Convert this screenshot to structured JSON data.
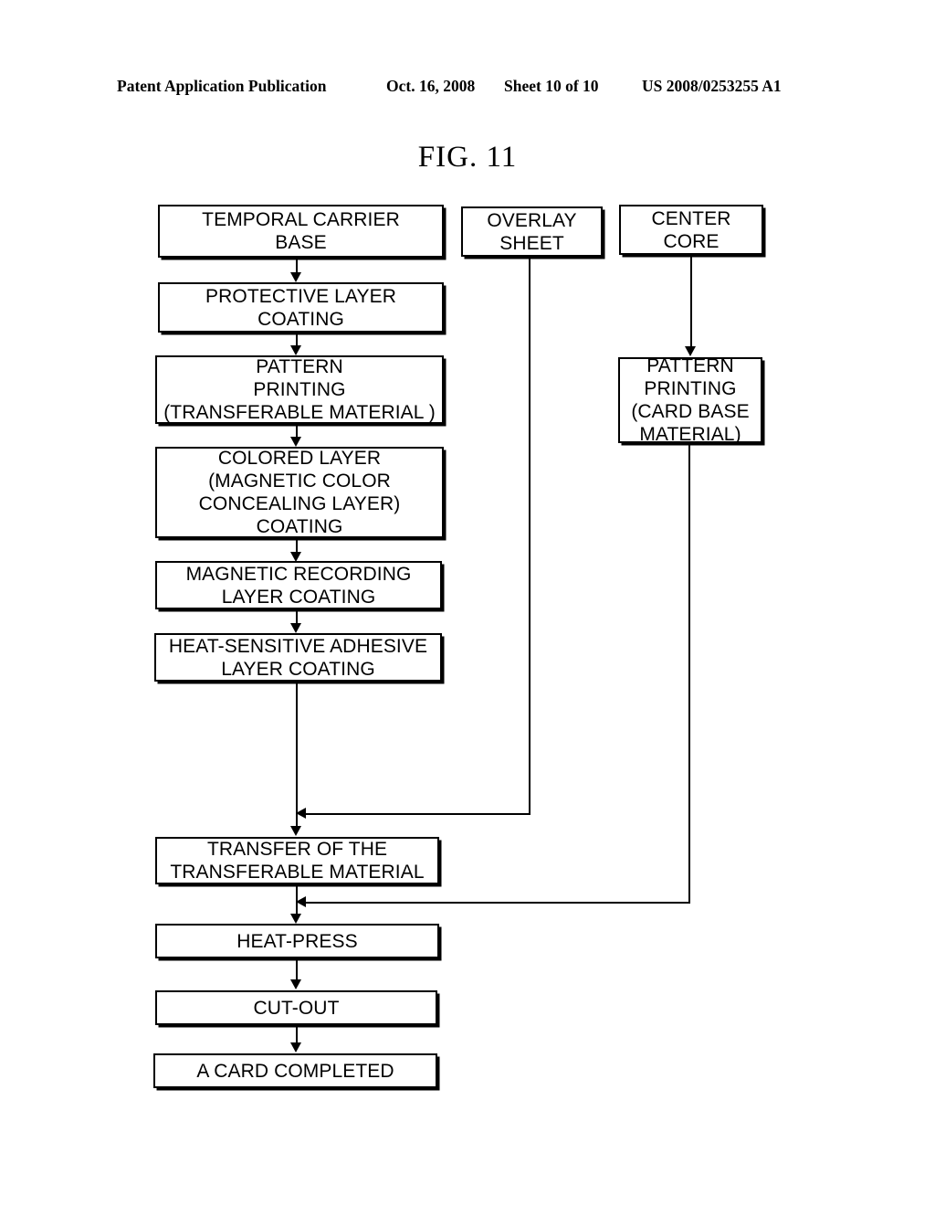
{
  "header": {
    "publication": "Patent Application Publication",
    "date": "Oct. 16, 2008",
    "sheet": "Sheet 10 of 10",
    "number": "US 2008/0253255 A1"
  },
  "figure": {
    "title": "FIG. 11"
  },
  "flowchart": {
    "nodes": {
      "temporal_carrier_base": "TEMPORAL CARRIER\nBASE",
      "protective_layer_coating": "PROTECTIVE LAYER\nCOATING",
      "pattern_printing_transferable": "PATTERN\nPRINTING\n(TRANSFERABLE MATERIAL )",
      "colored_layer_coating": "COLORED LAYER\n(MAGNETIC COLOR\nCONCEALING LAYER)\nCOATING",
      "magnetic_recording_layer_coating": "MAGNETIC RECORDING\nLAYER COATING",
      "heat_sensitive_adhesive_layer_coating": "HEAT-SENSITIVE ADHESIVE\nLAYER COATING",
      "overlay_sheet": "OVERLAY\nSHEET",
      "center_core": "CENTER\nCORE",
      "pattern_printing_card_base": "PATTERN\nPRINTING\n(CARD BASE\nMATERIAL)",
      "transfer_of_the_transferable_material": "TRANSFER OF THE\nTRANSFERABLE MATERIAL",
      "heat_press": "HEAT-PRESS",
      "cut_out": "CUT-OUT",
      "a_card_completed": "A CARD COMPLETED"
    },
    "colors": {
      "stroke": "#000000",
      "fill": "#ffffff"
    }
  }
}
